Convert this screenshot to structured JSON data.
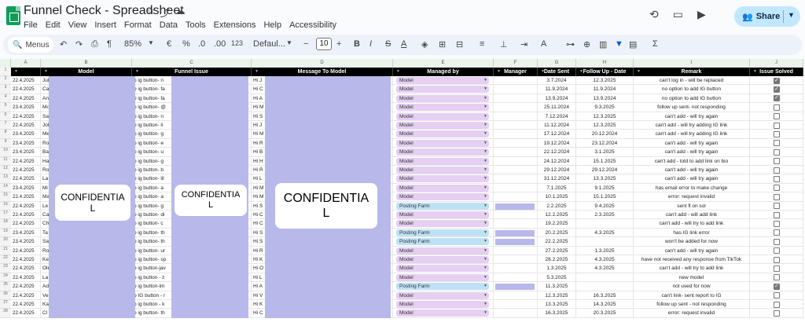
{
  "app": {
    "title": "Funnel Check - Spreadsheet",
    "menu": [
      "File",
      "Edit",
      "View",
      "Insert",
      "Format",
      "Data",
      "Tools",
      "Extensions",
      "Help",
      "Accessibility"
    ],
    "share_label": "Share",
    "icons": [
      "star-icon",
      "move-icon",
      "cloud-status-icon",
      "history-icon",
      "comment-icon",
      "meet-icon"
    ]
  },
  "toolbar": {
    "search_label": "Menus",
    "zoom": "85%",
    "currency": "€",
    "percent": "%",
    "dec_decrease": ".0",
    "dec_increase": ".00",
    "number_format": "123",
    "font": "Defaul...",
    "font_size": "10",
    "minus": "−",
    "plus": "+"
  },
  "columns": {
    "letters": [
      "A",
      "B",
      "C",
      "D",
      "E",
      "F",
      "G",
      "H",
      "I",
      "J"
    ],
    "headers": [
      "",
      "Model",
      "Funnel Issue",
      "Message To Model",
      "Managed by",
      "Manager",
      "Date Sent",
      "Follow Up - Date",
      "Remark",
      "Issue Solved"
    ]
  },
  "redaction_label_1": "CONFIDENTIA",
  "redaction_label_2": "L",
  "rows": [
    {
      "date": "22.4.2025",
      "model": "Jul",
      "issue": "o ig button- n",
      "msg": "Hi J",
      "managed": "Model",
      "sent": "3.7.2024",
      "follow": "12.3.2025",
      "remark": "can't log in - will be replaced",
      "solved": true
    },
    {
      "date": "22.4.2025",
      "model": "Ca",
      "issue": "o ig button- fa",
      "msg": "Hi C",
      "managed": "Model",
      "sent": "11.9.2024",
      "follow": "11.9.2024",
      "remark": "no option to add IG button",
      "solved": true
    },
    {
      "date": "22.4.2025",
      "model": "An",
      "issue": "o ig button- fa",
      "msg": "Hi A",
      "managed": "Model",
      "sent": "13.9.2024",
      "follow": "13.9.2024",
      "remark": "no option to add IG button",
      "solved": true
    },
    {
      "date": "23.4.2025",
      "model": "Mo",
      "issue": "o ig button- @",
      "msg": "Hi M",
      "managed": "Model",
      "sent": "25.11.2024",
      "follow": "9.3.2025",
      "remark": "follow up sent- not responding",
      "solved": false
    },
    {
      "date": "22.4.2025",
      "model": "Sa",
      "issue": "o ig button- n",
      "msg": "Hi S",
      "managed": "Model",
      "sent": "7.12.2024",
      "follow": "12.3.2025",
      "remark": "can't add - will try again",
      "solved": false
    },
    {
      "date": "22.4.2025",
      "model": "Jol",
      "issue": "o ig button- li",
      "msg": "Hi J",
      "managed": "Model",
      "sent": "11.12.2024",
      "follow": "12.3.2025",
      "remark": "can't add - will try adding IG link",
      "solved": false
    },
    {
      "date": "23.4.2025",
      "model": "Me",
      "issue": "o ig button- g",
      "msg": "Hi M",
      "managed": "Model",
      "sent": "17.12.2024",
      "follow": "20.12.2024",
      "remark": "can't add - will try adding IG link",
      "solved": false
    },
    {
      "date": "23.4.2025",
      "model": "Ro",
      "issue": "o ig button- e",
      "msg": "Hi R",
      "managed": "Model",
      "sent": "19.12.2024",
      "follow": "23.12.2024",
      "remark": "can't add - will try again",
      "solved": false
    },
    {
      "date": "23.4.2025",
      "model": "Ba",
      "issue": "o ig button- u",
      "msg": "Hi B",
      "managed": "Model",
      "sent": "22.12.2024",
      "follow": "3.1.2025",
      "remark": "can't add - will try again",
      "solved": false
    },
    {
      "date": "22.4.2025",
      "model": "Ha",
      "issue": "o ig button- g",
      "msg": "Hi H",
      "managed": "Model",
      "sent": "24.12.2024",
      "follow": "15.1.2025",
      "remark": "can't add - told to add link on bio",
      "solved": false
    },
    {
      "date": "22.4.2025",
      "model": "Ro",
      "issue": "o ig button- b",
      "msg": "Hi R",
      "managed": "Model",
      "sent": "29.12.2024",
      "follow": "29.12.2024",
      "remark": "can't add - will try again",
      "solved": false
    },
    {
      "date": "22.4.2025",
      "model": "La",
      "issue": "o ig button- lil",
      "msg": "Hi L",
      "managed": "Model",
      "sent": "31.12.2024",
      "follow": "13.3.2025",
      "remark": "can't add - will try again",
      "solved": false
    },
    {
      "date": "23.4.2025",
      "model": "Mi",
      "issue": "o ig button- a",
      "msg": "Hi M",
      "managed": "Model",
      "sent": "7.1.2025",
      "follow": "9.1.2025",
      "remark": "has email error to make change",
      "solved": false
    },
    {
      "date": "22.4.2025",
      "model": "Ma",
      "issue": "o ig button- a",
      "msg": "Hi M",
      "managed": "Model",
      "sent": "10.1.2025",
      "follow": "15.1.2025",
      "remark": "error: request invalid",
      "solved": false
    },
    {
      "date": "22.4.2025",
      "model": "Le",
      "issue": "o ig button- g",
      "msg": "Hi S",
      "managed": "Posting Farm",
      "sent": "2.2.2025",
      "follow": "9.4.2025",
      "remark": "sent fl on sol",
      "solved": false
    },
    {
      "date": "22.4.2025",
      "model": "Ca",
      "issue": "o ig button- di",
      "msg": "Hi C",
      "managed": "Model",
      "sent": "12.2.2025",
      "follow": "2.3.2025",
      "remark": "can't add - will add link",
      "solved": false
    },
    {
      "date": "22.4.2025",
      "model": "Ch",
      "issue": "o ig button- c",
      "msg": "Hi C",
      "managed": "Model",
      "sent": "19.2.2025",
      "follow": "",
      "remark": "can't add - will try to add link",
      "solved": false
    },
    {
      "date": "23.4.2025",
      "model": "Ta",
      "issue": "o ig button- th",
      "msg": "Hi S",
      "managed": "Posting Farm",
      "sent": "20.2.2025",
      "follow": "4.3.2025",
      "remark": "has IG link error",
      "solved": false
    },
    {
      "date": "23.4.2025",
      "model": "Sa",
      "issue": "o ig button- th",
      "msg": "Hi S",
      "managed": "Posting Farm",
      "sent": "22.2.2025",
      "follow": "",
      "remark": "won't be added for now",
      "solved": false
    },
    {
      "date": "22.4.2025",
      "model": "Ro",
      "issue": "o ig button- ur",
      "msg": "Hi R",
      "managed": "Model",
      "sent": "27.2.2025",
      "follow": "1.3.2025",
      "remark": "can't add - will try again",
      "solved": false
    },
    {
      "date": "22.4.2025",
      "model": "Ke",
      "issue": "o ig button- sp",
      "msg": "Hi K",
      "managed": "Model",
      "sent": "28.2.2025",
      "follow": "4.3.2025",
      "remark": "have not received any response from TikTok",
      "solved": false
    },
    {
      "date": "22.4.2025",
      "model": "Ole",
      "issue": "o ig button-jav",
      "msg": "Hi O",
      "managed": "Model",
      "sent": "1.3.2025",
      "follow": "4.3.2025",
      "remark": "can't add - will try to add link",
      "solved": false
    },
    {
      "date": "22.4.2025",
      "model": "La",
      "issue": "o ig button - z",
      "msg": "Hi L",
      "managed": "Model",
      "sent": "5.3.2025",
      "follow": "",
      "remark": "new model",
      "solved": false
    },
    {
      "date": "22.4.2025",
      "model": "Ad",
      "issue": "o ig button-im",
      "msg": "Hi A",
      "managed": "Posting Farm",
      "sent": "11.3.2025",
      "follow": "",
      "remark": "not used for now",
      "solved": true
    },
    {
      "date": "22.4.2025",
      "model": "Ve",
      "issue": "o IG button - r",
      "msg": "Hi V",
      "managed": "Model",
      "sent": "12.3.2025",
      "follow": "16.3.2025",
      "remark": "can't link- sent report to IG",
      "solved": false
    },
    {
      "date": "22.4.2025",
      "model": "Ka",
      "issue": "o ig button - k",
      "msg": "Hi K",
      "managed": "Model",
      "sent": "13.3.2025",
      "follow": "14.3.2025",
      "remark": "follow up sent - not responding",
      "solved": false
    },
    {
      "date": "22.4.2025",
      "model": "Cl",
      "issue": "o ig button- th",
      "msg": "Hi C",
      "managed": "Model",
      "sent": "16.3.2025",
      "follow": "20.3.2025",
      "remark": "error: request invalid",
      "solved": false
    }
  ],
  "colors": {
    "model_chip": "#e5cff2",
    "farm_chip": "#bfe1f6",
    "redaction": "#b8b8ea",
    "header_bg": "#000000"
  }
}
